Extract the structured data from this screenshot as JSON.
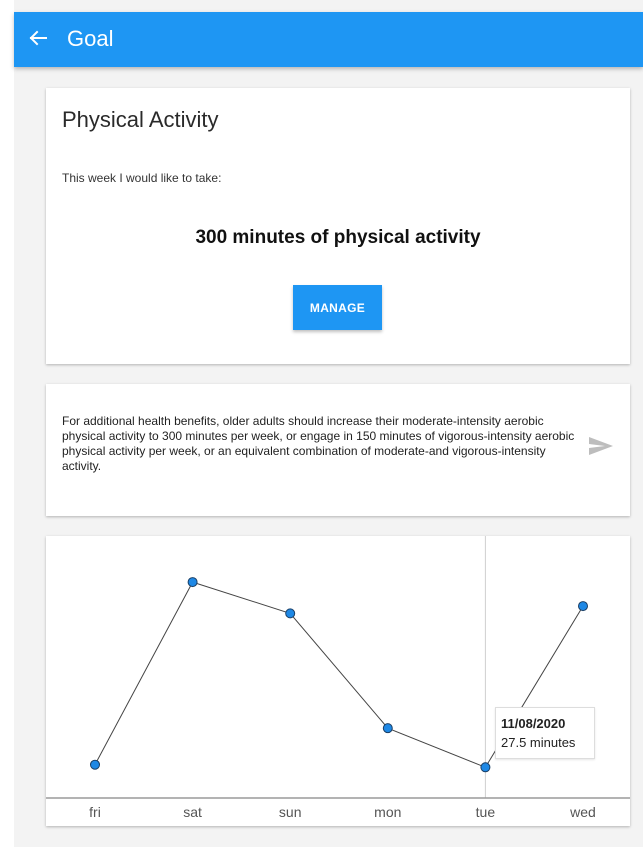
{
  "app_bar": {
    "title": "Goal",
    "back_icon": "arrow-back-icon",
    "color": "#1e96f3"
  },
  "goal_card": {
    "title": "Physical Activity",
    "subtitle": "This week I would like to take:",
    "goal_text": "300 minutes of physical activity",
    "manage_label": "MANAGE"
  },
  "tip_card": {
    "text": "For additional health benefits, older adults should increase their moderate-intensity aerobic physical activity to 300 minutes per week, or engage in 150 minutes of vigorous-intensity aerobic physical activity per week, or an equivalent combination of moderate-and vigorous-intensity activity.",
    "send_icon": "send-icon"
  },
  "chart_data": {
    "type": "line",
    "categories": [
      "fri",
      "sat",
      "sun",
      "mon",
      "tue",
      "wed"
    ],
    "values": [
      30,
      205,
      175,
      65,
      27.5,
      182
    ],
    "title": "",
    "xlabel": "",
    "ylabel": "",
    "ylim": [
      0,
      230
    ],
    "grid": false,
    "point_color": "#1e88e5",
    "line_color": "#444444",
    "tooltip": {
      "category": "tue",
      "date": "11/08/2020",
      "value_text": "27.5 minutes"
    }
  }
}
